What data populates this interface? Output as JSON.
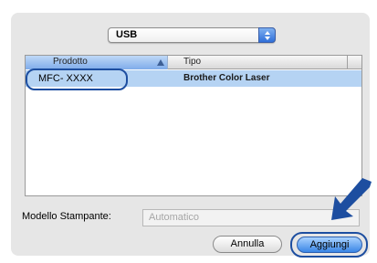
{
  "connection_popup": {
    "value": "USB"
  },
  "list": {
    "columns": [
      "Prodotto",
      "Tipo"
    ],
    "rows": [
      {
        "product": "MFC- XXXX",
        "type": "Brother Color Laser"
      }
    ]
  },
  "model": {
    "label": "Modello Stampante:",
    "value": "Automatico"
  },
  "buttons": {
    "cancel": "Annulla",
    "add": "Aggiungi"
  },
  "colors": {
    "highlight_ring": "#1d4ea0",
    "selection": "#b5d3f3",
    "default_button": "#3a86e6"
  }
}
